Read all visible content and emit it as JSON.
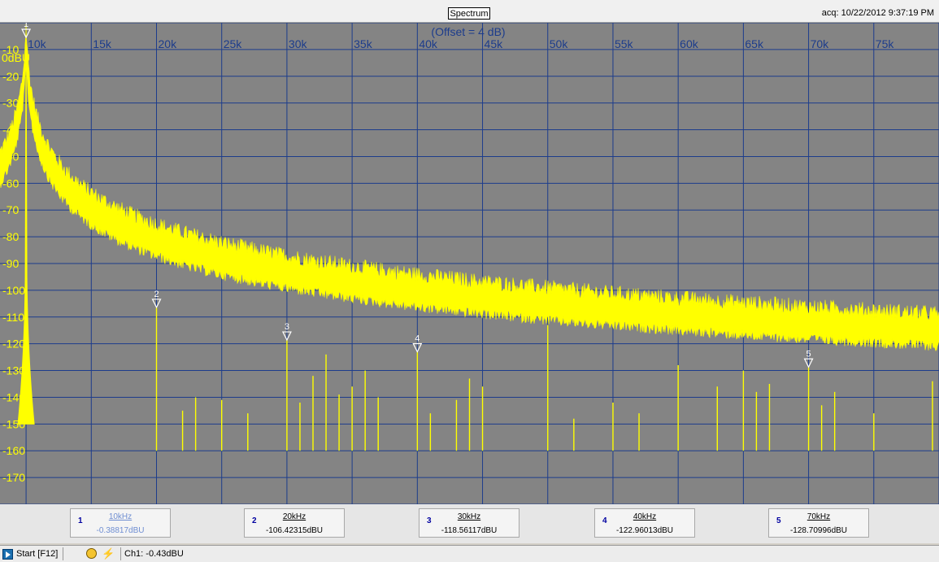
{
  "window": {
    "title": "Spectrum",
    "acq_label": "acq: 10/22/2012 9:37:19 PM"
  },
  "plot": {
    "offset_label": "(Offset = 4 dB)",
    "y_unit_label": "0dBU",
    "x_ticks": [
      "10k",
      "15k",
      "20k",
      "25k",
      "30k",
      "35k",
      "40k",
      "45k",
      "50k",
      "55k",
      "60k",
      "65k",
      "70k",
      "75k"
    ],
    "y_ticks": [
      "-10",
      "-20",
      "-30",
      "-40",
      "-50",
      "-60",
      "-70",
      "-80",
      "-90",
      "-100",
      "-110",
      "-120",
      "-130",
      "-140",
      "-150",
      "-160",
      "-170"
    ],
    "colors": {
      "background": "#848484",
      "grid": "#1c3c8c",
      "trace": "#ffff00",
      "marker": "#ffffff"
    }
  },
  "chart_data": {
    "type": "line",
    "x_unit": "Hz",
    "y_unit": "dBU",
    "xlim": [
      8000,
      80000
    ],
    "ylim": [
      -180,
      0
    ],
    "grid": true,
    "noise_floor": -158,
    "peaks": [
      {
        "x": 10000,
        "y": -0.39
      },
      {
        "x": 20000,
        "y": -106.4
      },
      {
        "x": 22000,
        "y": -145
      },
      {
        "x": 23000,
        "y": -140
      },
      {
        "x": 25000,
        "y": -141
      },
      {
        "x": 27000,
        "y": -146
      },
      {
        "x": 30000,
        "y": -118.6
      },
      {
        "x": 31000,
        "y": -142
      },
      {
        "x": 32000,
        "y": -132
      },
      {
        "x": 33000,
        "y": -124
      },
      {
        "x": 34000,
        "y": -139
      },
      {
        "x": 35000,
        "y": -136
      },
      {
        "x": 36000,
        "y": -130
      },
      {
        "x": 37000,
        "y": -140
      },
      {
        "x": 40000,
        "y": -123.0
      },
      {
        "x": 41000,
        "y": -146
      },
      {
        "x": 43000,
        "y": -141
      },
      {
        "x": 44000,
        "y": -133
      },
      {
        "x": 45000,
        "y": -136
      },
      {
        "x": 50000,
        "y": -113
      },
      {
        "x": 52000,
        "y": -148
      },
      {
        "x": 55000,
        "y": -142
      },
      {
        "x": 57000,
        "y": -146
      },
      {
        "x": 60000,
        "y": -128
      },
      {
        "x": 63000,
        "y": -136
      },
      {
        "x": 65000,
        "y": -130
      },
      {
        "x": 66000,
        "y": -138
      },
      {
        "x": 67000,
        "y": -135
      },
      {
        "x": 70000,
        "y": -128.7
      },
      {
        "x": 71000,
        "y": -143
      },
      {
        "x": 72000,
        "y": -138
      },
      {
        "x": 75000,
        "y": -146
      },
      {
        "x": 79500,
        "y": -134
      }
    ],
    "bumps": [
      {
        "x": 33000,
        "y": -152
      },
      {
        "x": 66000,
        "y": -150
      },
      {
        "x": 79500,
        "y": -140
      }
    ],
    "markers": [
      {
        "id": "1",
        "x": 10000,
        "y": -0.39
      },
      {
        "id": "2",
        "x": 20000,
        "y": -106.4
      },
      {
        "id": "3",
        "x": 30000,
        "y": -118.6
      },
      {
        "id": "4",
        "x": 40000,
        "y": -123.0
      },
      {
        "id": "5",
        "x": 70000,
        "y": -128.7
      }
    ]
  },
  "marker_panel": [
    {
      "num": "1",
      "freq": "10kHz",
      "level": "-0.38817dBU",
      "active": true
    },
    {
      "num": "2",
      "freq": "20kHz",
      "level": "-106.42315dBU",
      "active": false
    },
    {
      "num": "3",
      "freq": "30kHz",
      "level": "-118.56117dBU",
      "active": false
    },
    {
      "num": "4",
      "freq": "40kHz",
      "level": "-122.96013dBU",
      "active": false
    },
    {
      "num": "5",
      "freq": "70kHz",
      "level": "-128.70996dBU",
      "active": false
    }
  ],
  "statusbar": {
    "start_label": "Start [F12]",
    "channel_readout": "Ch1: -0.43dBU",
    "icons": [
      "play-icon",
      "clock-icon",
      "probe-icon"
    ]
  }
}
